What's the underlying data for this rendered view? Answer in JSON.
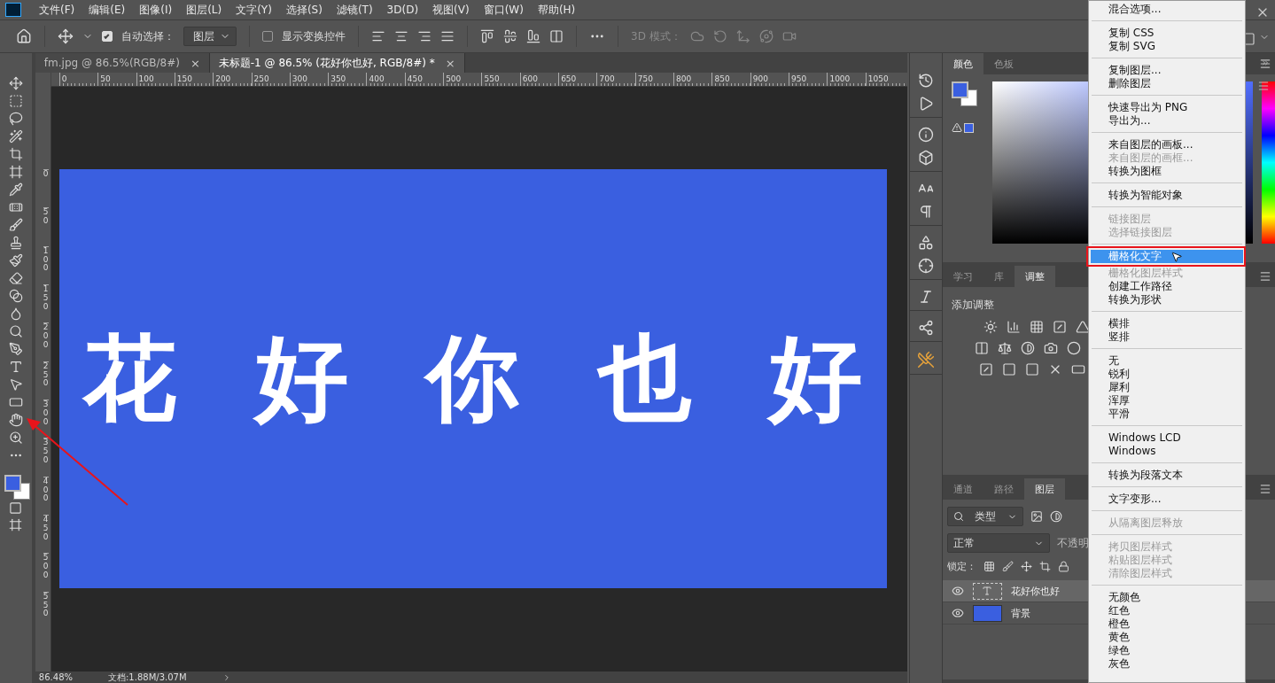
{
  "menu_bar": {
    "items": [
      "文件(F)",
      "编辑(E)",
      "图像(I)",
      "图层(L)",
      "文字(Y)",
      "选择(S)",
      "滤镜(T)",
      "3D(D)",
      "视图(V)",
      "窗口(W)",
      "帮助(H)"
    ]
  },
  "options_bar": {
    "auto_select": {
      "label": "自动选择：",
      "checked": true
    },
    "target": "图层",
    "show_transform": {
      "label": "显示变换控件",
      "checked": false
    },
    "mode_3d_label": "3D 模式："
  },
  "document_tabs": [
    {
      "label": "fm.jpg @ 86.5%(RGB/8#)",
      "selected": false,
      "close": "×"
    },
    {
      "label": "未标题-1 @ 86.5% (花好你也好, RGB/8#) *",
      "selected": true,
      "close": "×"
    }
  ],
  "rulers": {
    "horizontal": [
      "0",
      "50",
      "100",
      "150",
      "200",
      "250",
      "300",
      "350",
      "400",
      "450",
      "500",
      "550",
      "600",
      "650",
      "700",
      "750",
      "800",
      "850",
      "900",
      "950",
      "1000",
      "1050"
    ],
    "vertical": [
      "0",
      "50",
      "100",
      "150",
      "200",
      "250",
      "300",
      "350",
      "400",
      "450",
      "500",
      "550"
    ]
  },
  "canvas": {
    "text": "花 好 你 也 好"
  },
  "color_panel": {
    "tabs": [
      {
        "label": "颜色",
        "selected": true
      },
      {
        "label": "色板",
        "selected": false
      }
    ]
  },
  "adjustments_panel": {
    "tabs": [
      {
        "label": "学习",
        "selected": false
      },
      {
        "label": "库",
        "selected": false
      },
      {
        "label": "调整",
        "selected": true
      }
    ],
    "heading": "添加调整"
  },
  "layers_panel": {
    "tabs": [
      {
        "label": "通道",
        "selected": false
      },
      {
        "label": "路径",
        "selected": false
      },
      {
        "label": "图层",
        "selected": true
      }
    ],
    "filter": "类型",
    "blend_mode": "正常",
    "opacity_label": "不透明",
    "lock_label": "锁定：",
    "layers": [
      {
        "name": "花好你也好",
        "kind": "text",
        "selected": true,
        "visible": true
      },
      {
        "name": "背景",
        "kind": "fill",
        "selected": false,
        "visible": true
      }
    ]
  },
  "context_menu": {
    "groups": [
      [
        {
          "label": "混合选项...",
          "disabled": false,
          "selected": false
        }
      ],
      [
        {
          "label": "复制 CSS",
          "disabled": false,
          "selected": false
        },
        {
          "label": "复制 SVG",
          "disabled": false,
          "selected": false
        }
      ],
      [
        {
          "label": "复制图层...",
          "disabled": false,
          "selected": false
        },
        {
          "label": "删除图层",
          "disabled": false,
          "selected": false
        }
      ],
      [
        {
          "label": "快速导出为 PNG",
          "disabled": false,
          "selected": false
        },
        {
          "label": "导出为...",
          "disabled": false,
          "selected": false
        }
      ],
      [
        {
          "label": "来自图层的画板...",
          "disabled": false,
          "selected": false
        },
        {
          "label": "来自图层的画框...",
          "disabled": true,
          "selected": false
        },
        {
          "label": "转换为图框",
          "disabled": false,
          "selected": false
        }
      ],
      [
        {
          "label": "转换为智能对象",
          "disabled": false,
          "selected": false
        }
      ],
      [
        {
          "label": "链接图层",
          "disabled": true,
          "selected": false
        },
        {
          "label": "选择链接图层",
          "disabled": true,
          "selected": false
        }
      ],
      [
        {
          "label": "栅格化文字",
          "disabled": false,
          "selected": true
        },
        {
          "label": "栅格化图层样式",
          "disabled": true,
          "selected": false
        },
        {
          "label": "创建工作路径",
          "disabled": false,
          "selected": false
        },
        {
          "label": "转换为形状",
          "disabled": false,
          "selected": false
        }
      ],
      [
        {
          "label": "横排",
          "disabled": false,
          "selected": false
        },
        {
          "label": "竖排",
          "disabled": false,
          "selected": false
        }
      ],
      [
        {
          "label": "无",
          "disabled": false,
          "selected": false
        },
        {
          "label": "锐利",
          "disabled": false,
          "selected": false
        },
        {
          "label": "犀利",
          "disabled": false,
          "selected": false
        },
        {
          "label": "浑厚",
          "disabled": false,
          "selected": false
        },
        {
          "label": "平滑",
          "disabled": false,
          "selected": false
        }
      ],
      [
        {
          "label": "Windows LCD",
          "disabled": false,
          "selected": false
        },
        {
          "label": "Windows",
          "disabled": false,
          "selected": false
        }
      ],
      [
        {
          "label": "转换为段落文本",
          "disabled": false,
          "selected": false
        }
      ],
      [
        {
          "label": "文字变形...",
          "disabled": false,
          "selected": false
        }
      ],
      [
        {
          "label": "从隔离图层释放",
          "disabled": true,
          "selected": false
        }
      ],
      [
        {
          "label": "拷贝图层样式",
          "disabled": true,
          "selected": false
        },
        {
          "label": "粘贴图层样式",
          "disabled": true,
          "selected": false
        },
        {
          "label": "清除图层样式",
          "disabled": true,
          "selected": false
        }
      ],
      [
        {
          "label": "无颜色",
          "disabled": false,
          "selected": false
        },
        {
          "label": "红色",
          "disabled": false,
          "selected": false
        },
        {
          "label": "橙色",
          "disabled": false,
          "selected": false
        },
        {
          "label": "黄色",
          "disabled": false,
          "selected": false
        },
        {
          "label": "绿色",
          "disabled": false,
          "selected": false
        },
        {
          "label": "灰色",
          "disabled": false,
          "selected": false
        }
      ]
    ]
  },
  "status_bar": {
    "zoom": "86.48%",
    "doc_size": "文档:1.88M/3.07M"
  }
}
